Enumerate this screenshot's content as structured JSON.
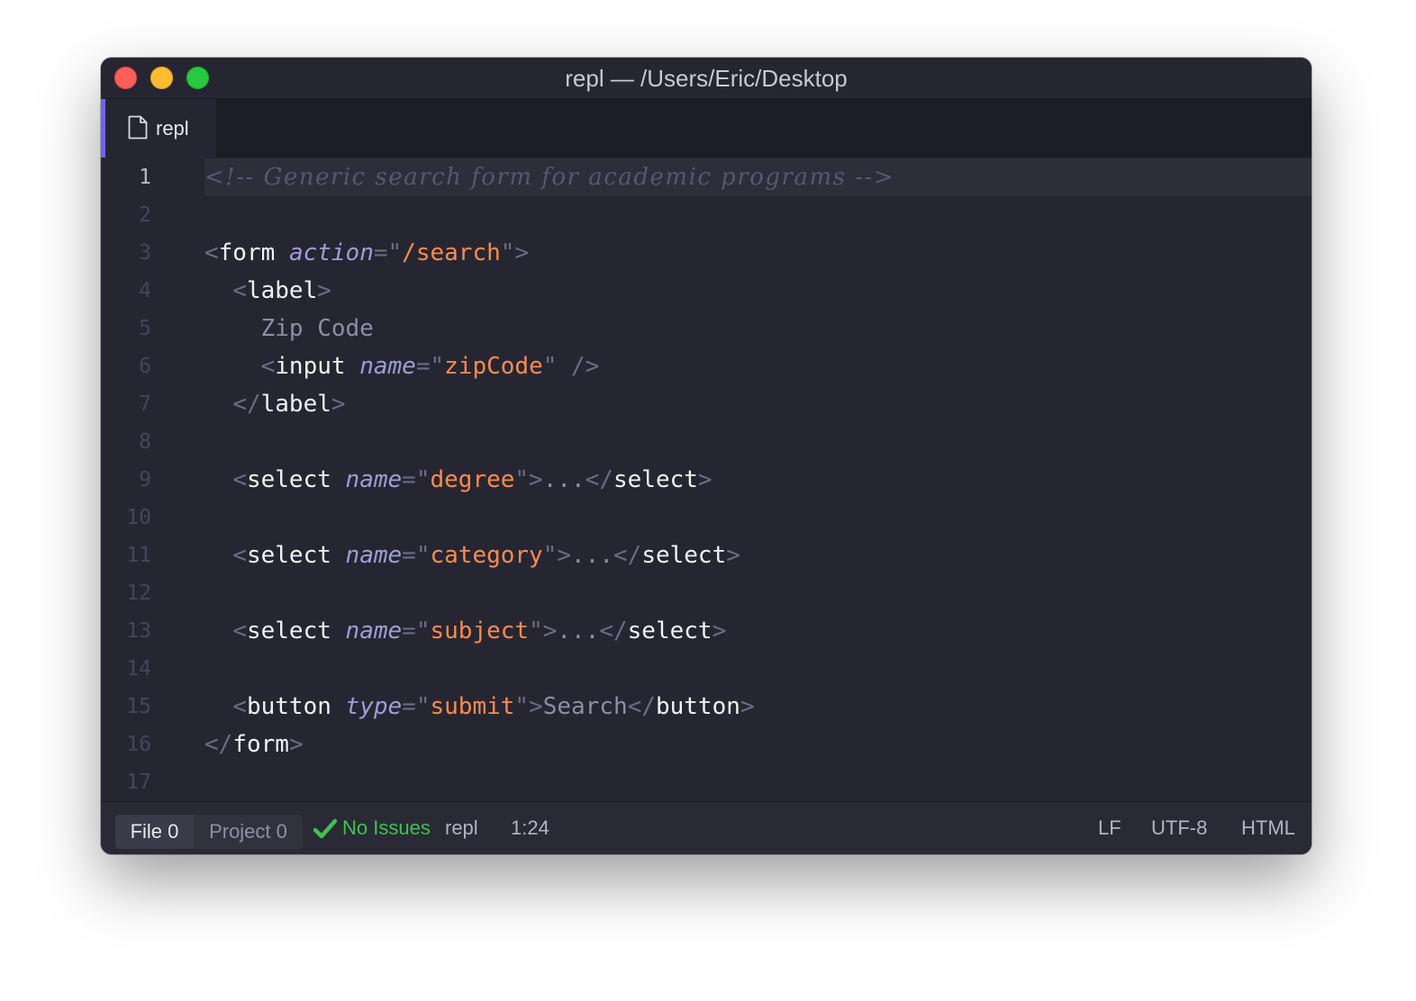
{
  "window": {
    "title": "repl — /Users/Eric/Desktop"
  },
  "tabs": [
    {
      "label": "repl",
      "icon": "file-icon",
      "active": true
    }
  ],
  "editor": {
    "active_line": 1,
    "line_numbers": [
      "1",
      "2",
      "3",
      "4",
      "5",
      "6",
      "7",
      "8",
      "9",
      "10",
      "11",
      "12",
      "13",
      "14",
      "15",
      "16",
      "17"
    ],
    "lines": [
      [
        {
          "t": "comment",
          "v": "<!-- Generic search form for academic programs -->"
        }
      ],
      [],
      [
        {
          "t": "punc",
          "v": "<"
        },
        {
          "t": "tag",
          "v": "form"
        },
        {
          "t": "txt",
          "v": " "
        },
        {
          "t": "attr",
          "v": "action"
        },
        {
          "t": "punc",
          "v": "=\""
        },
        {
          "t": "str",
          "v": "/search"
        },
        {
          "t": "punc",
          "v": "\">"
        }
      ],
      [
        {
          "t": "txt",
          "v": "  "
        },
        {
          "t": "punc",
          "v": "<"
        },
        {
          "t": "tag",
          "v": "label"
        },
        {
          "t": "punc",
          "v": ">"
        }
      ],
      [
        {
          "t": "txt",
          "v": "    Zip Code"
        }
      ],
      [
        {
          "t": "txt",
          "v": "    "
        },
        {
          "t": "punc",
          "v": "<"
        },
        {
          "t": "tag",
          "v": "input"
        },
        {
          "t": "txt",
          "v": " "
        },
        {
          "t": "attr",
          "v": "name"
        },
        {
          "t": "punc",
          "v": "=\""
        },
        {
          "t": "str",
          "v": "zipCode"
        },
        {
          "t": "punc",
          "v": "\" />"
        }
      ],
      [
        {
          "t": "txt",
          "v": "  "
        },
        {
          "t": "punc",
          "v": "</"
        },
        {
          "t": "tag",
          "v": "label"
        },
        {
          "t": "punc",
          "v": ">"
        }
      ],
      [],
      [
        {
          "t": "txt",
          "v": "  "
        },
        {
          "t": "punc",
          "v": "<"
        },
        {
          "t": "tag",
          "v": "select"
        },
        {
          "t": "txt",
          "v": " "
        },
        {
          "t": "attr",
          "v": "name"
        },
        {
          "t": "punc",
          "v": "=\""
        },
        {
          "t": "str",
          "v": "degree"
        },
        {
          "t": "punc",
          "v": "\">"
        },
        {
          "t": "txt",
          "v": "..."
        },
        {
          "t": "punc",
          "v": "</"
        },
        {
          "t": "tag",
          "v": "select"
        },
        {
          "t": "punc",
          "v": ">"
        }
      ],
      [],
      [
        {
          "t": "txt",
          "v": "  "
        },
        {
          "t": "punc",
          "v": "<"
        },
        {
          "t": "tag",
          "v": "select"
        },
        {
          "t": "txt",
          "v": " "
        },
        {
          "t": "attr",
          "v": "name"
        },
        {
          "t": "punc",
          "v": "=\""
        },
        {
          "t": "str",
          "v": "category"
        },
        {
          "t": "punc",
          "v": "\">"
        },
        {
          "t": "txt",
          "v": "..."
        },
        {
          "t": "punc",
          "v": "</"
        },
        {
          "t": "tag",
          "v": "select"
        },
        {
          "t": "punc",
          "v": ">"
        }
      ],
      [],
      [
        {
          "t": "txt",
          "v": "  "
        },
        {
          "t": "punc",
          "v": "<"
        },
        {
          "t": "tag",
          "v": "select"
        },
        {
          "t": "txt",
          "v": " "
        },
        {
          "t": "attr",
          "v": "name"
        },
        {
          "t": "punc",
          "v": "=\""
        },
        {
          "t": "str",
          "v": "subject"
        },
        {
          "t": "punc",
          "v": "\">"
        },
        {
          "t": "txt",
          "v": "..."
        },
        {
          "t": "punc",
          "v": "</"
        },
        {
          "t": "tag",
          "v": "select"
        },
        {
          "t": "punc",
          "v": ">"
        }
      ],
      [],
      [
        {
          "t": "txt",
          "v": "  "
        },
        {
          "t": "punc",
          "v": "<"
        },
        {
          "t": "tag",
          "v": "button"
        },
        {
          "t": "txt",
          "v": " "
        },
        {
          "t": "attr",
          "v": "type"
        },
        {
          "t": "punc",
          "v": "=\""
        },
        {
          "t": "str",
          "v": "submit"
        },
        {
          "t": "punc",
          "v": "\">"
        },
        {
          "t": "txt",
          "v": "Search"
        },
        {
          "t": "punc",
          "v": "</"
        },
        {
          "t": "tag",
          "v": "button"
        },
        {
          "t": "punc",
          "v": ">"
        }
      ],
      [
        {
          "t": "punc",
          "v": "</"
        },
        {
          "t": "tag",
          "v": "form"
        },
        {
          "t": "punc",
          "v": ">"
        }
      ],
      []
    ]
  },
  "status": {
    "file_label": "File",
    "file_count": "0",
    "project_label": "Project",
    "project_count": "0",
    "check_icon": "check-icon",
    "linter": "No Issues",
    "linter_color": "#3fc24e",
    "grammar_name": "repl",
    "cursor": "1:24",
    "line_ending": "LF",
    "encoding": "UTF-8",
    "language": "HTML"
  },
  "colors": {
    "accent": "#6f62ff",
    "string": "#ff8b4f",
    "attribute": "#9f9dd6",
    "close": "#fe5f57",
    "minimize": "#febc2e",
    "maximize": "#28c840"
  }
}
